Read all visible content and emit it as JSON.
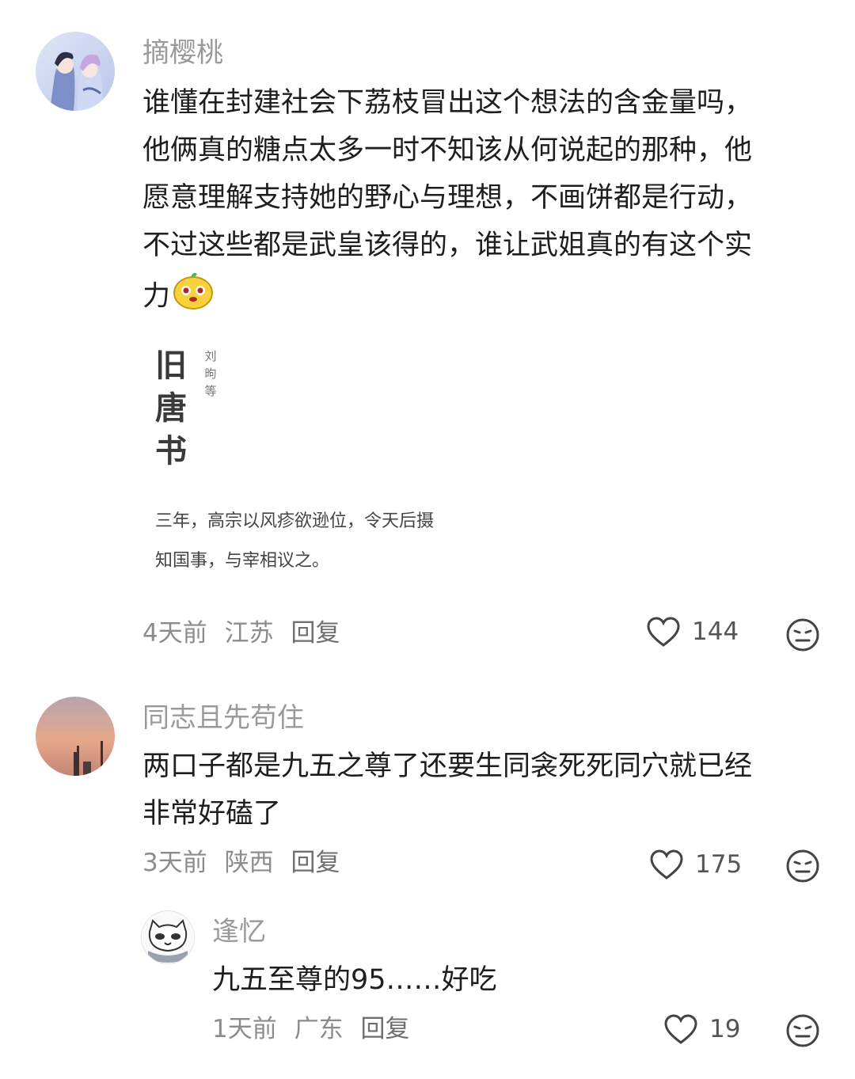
{
  "comments": [
    {
      "username": "摘樱桃",
      "lines": [
        "谁懂在封建社会下荔枝冒出这个想法的含金量吗，",
        "他俩真的糖点太多一时不知该从何说起的那种，他",
        "愿意理解支持她的野心与理想，不画饼都是行动，",
        "不过这些都是武皇该得的，谁让武姐真的有这个实",
        "力"
      ],
      "emoji": "cute-yellow-face-emoji",
      "quote_image": {
        "book_title": [
          "旧",
          "唐",
          "书"
        ],
        "author": [
          "刘",
          "昫",
          "等"
        ],
        "text_line1": "三年，高宗以风疹欲逊位，令天后摄",
        "text_line2": "知国事，与宰相议之。"
      },
      "time": "4天前",
      "location": "江苏",
      "reply_label": "回复",
      "likes": "144"
    },
    {
      "username": "同志且先苟住",
      "lines": [
        "两口子都是九五之尊了还要生同衾死死同穴就已经",
        "非常好磕了"
      ],
      "time": "3天前",
      "location": "陕西",
      "reply_label": "回复",
      "likes": "175"
    },
    {
      "username": "逢忆",
      "lines": [
        "九五至尊的95……好吃"
      ],
      "time": "1天前",
      "location": "广东",
      "reply_label": "回复",
      "likes": "19"
    }
  ],
  "icons": {
    "like": "heart-outline-icon",
    "emoji_react": "meh-face-icon"
  },
  "colors": {
    "username": "#9a9a9a",
    "meta": "#8c8c8c",
    "content": "#1e1e1e"
  }
}
